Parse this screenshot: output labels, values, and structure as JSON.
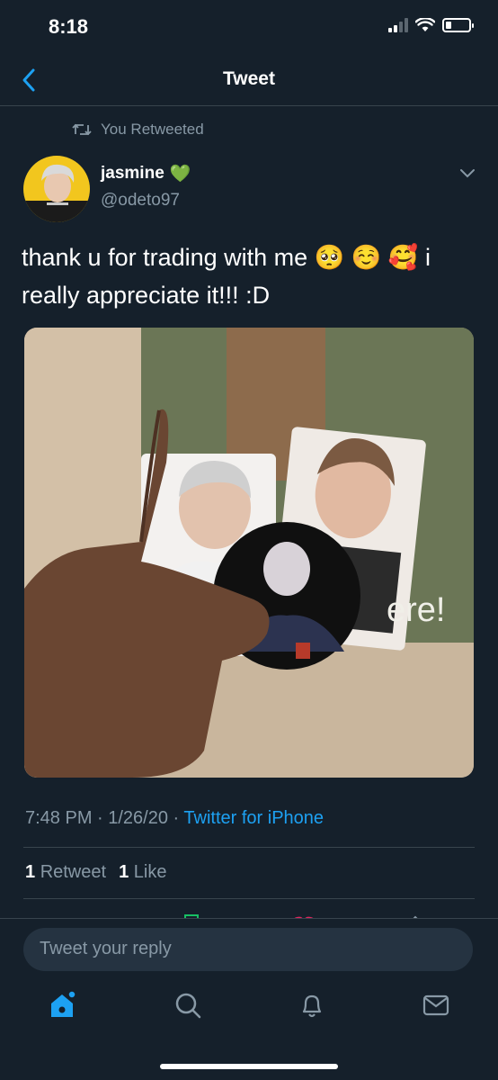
{
  "status_bar": {
    "time": "8:18",
    "battery_level": 0.25
  },
  "nav": {
    "title": "Tweet",
    "back_icon": "chevron-left-icon"
  },
  "retweet_context": {
    "text": "You Retweeted",
    "icon": "retweet-icon"
  },
  "author": {
    "name": "jasmine",
    "name_emoji": "💚",
    "handle": "@odeto97"
  },
  "tweet": {
    "text": "thank u for trading with me 🥺 ☺️ 🥰 i really appreciate it!!! :D",
    "media_text": "ere!",
    "timestamp": "7:48 PM · 1/26/20 · ",
    "source": "Twitter for iPhone"
  },
  "stats": {
    "retweets": "1",
    "retweets_label": "Retweet",
    "likes": "1",
    "likes_label": "Like"
  },
  "reply": {
    "placeholder": "Tweet your reply"
  },
  "tabs": [
    "home-icon",
    "search-icon",
    "notifications-icon",
    "messages-icon"
  ],
  "colors": {
    "background": "#15202b",
    "accent": "#1da1f2",
    "secondary_text": "#8899a6",
    "divider": "#38444d"
  }
}
